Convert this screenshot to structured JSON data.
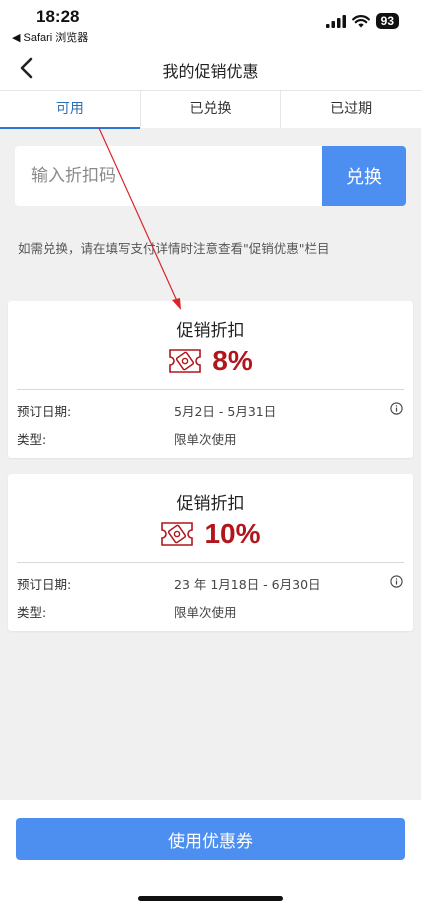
{
  "status_bar": {
    "time": "18:28",
    "back_app": "◀ Safari 浏览器",
    "battery": "93",
    "icons": [
      "signal-icon",
      "wifi-icon",
      "battery-icon"
    ]
  },
  "nav": {
    "title": "我的促销优惠",
    "back_icon": "chevron-left-icon"
  },
  "tabs": [
    {
      "label": "可用",
      "active": true
    },
    {
      "label": "已兑换",
      "active": false
    },
    {
      "label": "已过期",
      "active": false
    }
  ],
  "redeem": {
    "placeholder": "输入折扣码",
    "value": "",
    "button_label": "兑换"
  },
  "hint": "如需兑换，请在填写支付详情时注意查看\"促销优惠\"栏目",
  "coupons": [
    {
      "title": "促销折扣",
      "discount": "8%",
      "date_label": "预订日期:",
      "date_value": "5月2日 - 5月31日",
      "type_label": "类型:",
      "type_value": "限单次使用",
      "icon": "coupon-ticket-icon"
    },
    {
      "title": "促销折扣",
      "discount": "10%",
      "date_label": "预订日期:",
      "date_value": "23 年 1月18日 - 6月30日",
      "type_label": "类型:",
      "type_value": "限单次使用",
      "icon": "coupon-ticket-icon"
    }
  ],
  "bottom": {
    "button_label": "使用优惠券"
  },
  "colors": {
    "accent": "#4d8ff0",
    "tab_active": "#2d6fb6",
    "discount_red": "#b0161b",
    "annotation_arrow": "#d9252a",
    "background": "#f0f0f1"
  }
}
